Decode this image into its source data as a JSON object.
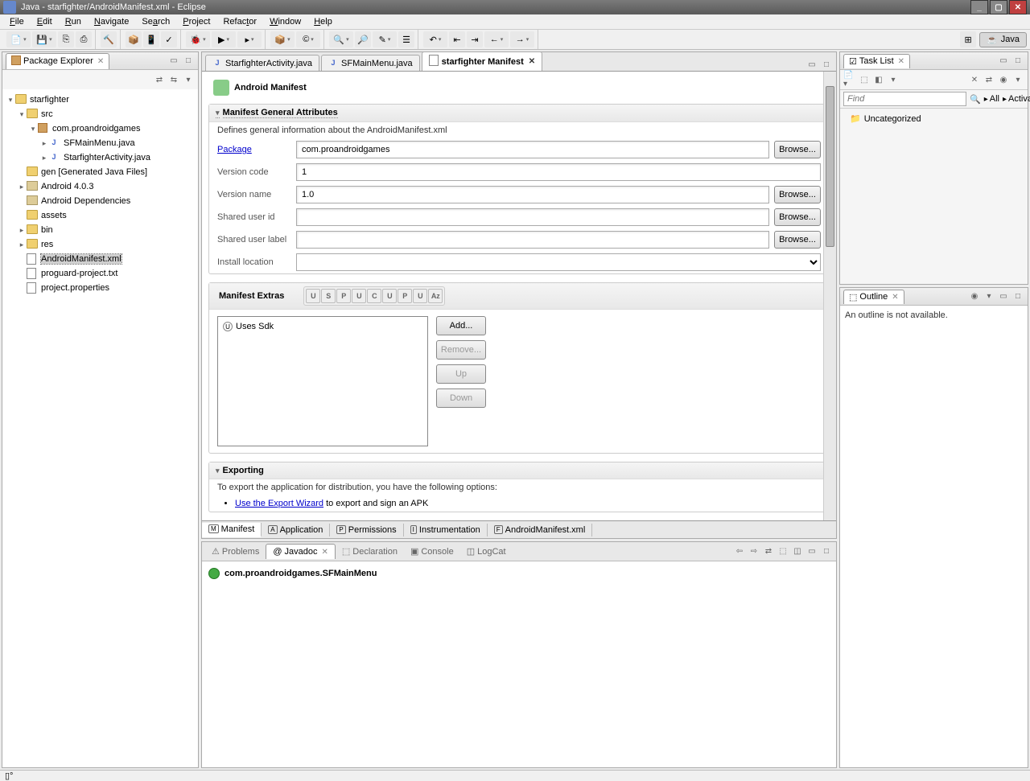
{
  "window": {
    "title": "Java - starfighter/AndroidManifest.xml - Eclipse"
  },
  "menu": {
    "file": "File",
    "edit": "Edit",
    "run": "Run",
    "navigate": "Navigate",
    "search": "Search",
    "project": "Project",
    "refactor": "Refactor",
    "window": "Window",
    "help": "Help"
  },
  "perspective": {
    "java": "Java"
  },
  "packageExplorer": {
    "title": "Package Explorer",
    "tree": {
      "project": "starfighter",
      "src": "src",
      "pkg": "com.proandroidgames",
      "f1": "SFMainMenu.java",
      "f2": "StarfighterActivity.java",
      "gen": "gen",
      "genNote": "[Generated Java Files]",
      "android": "Android 4.0.3",
      "deps": "Android Dependencies",
      "assets": "assets",
      "bin": "bin",
      "res": "res",
      "manifest": "AndroidManifest.xml",
      "proguard": "proguard-project.txt",
      "props": "project.properties"
    }
  },
  "editorTabs": {
    "t1": "StarfighterActivity.java",
    "t2": "SFMainMenu.java",
    "t3": "starfighter Manifest"
  },
  "editor": {
    "title": "Android Manifest",
    "generalHeader": "Manifest General Attributes",
    "generalDesc": "Defines general information about the AndroidManifest.xml",
    "labels": {
      "package": "Package",
      "versionCode": "Version code",
      "versionName": "Version name",
      "sharedUserId": "Shared user id",
      "sharedUserLabel": "Shared user label",
      "installLocation": "Install location"
    },
    "values": {
      "package": "com.proandroidgames",
      "versionCode": "1",
      "versionName": "1.0",
      "sharedUserId": "",
      "sharedUserLabel": "",
      "installLocation": ""
    },
    "browse": "Browse...",
    "extrasHeader": "Manifest Extras",
    "extrasItem": "Uses Sdk",
    "buttons": {
      "add": "Add...",
      "remove": "Remove...",
      "up": "Up",
      "down": "Down"
    },
    "exportHeader": "Exporting",
    "exportDesc": "To export the application for distribution, you have the following options:",
    "exportLink": "Use the Export Wizard",
    "exportAfter": " to export and sign an APK",
    "bottomTabs": {
      "manifest": "Manifest",
      "application": "Application",
      "permissions": "Permissions",
      "instrumentation": "Instrumentation",
      "xml": "AndroidManifest.xml"
    }
  },
  "task": {
    "title": "Task List",
    "find": "Find",
    "all": "All",
    "activate": "Activate...",
    "uncategorized": "Uncategorized"
  },
  "outline": {
    "title": "Outline",
    "empty": "An outline is not available."
  },
  "bottom": {
    "problems": "Problems",
    "javadoc": "Javadoc",
    "declaration": "Declaration",
    "console": "Console",
    "logcat": "LogCat",
    "content": "com.proandroidgames.SFMainMenu"
  }
}
